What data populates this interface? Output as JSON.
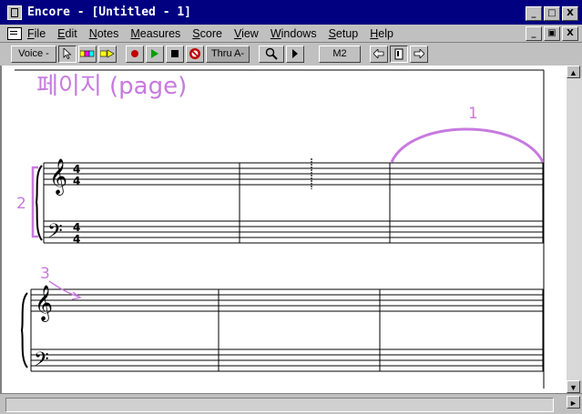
{
  "window": {
    "title": "Encore - [Untitled - 1]",
    "minimize_glyph": "_",
    "restore_glyph": "□",
    "close_glyph": "X"
  },
  "doc_controls": {
    "minimize_glyph": "_",
    "restore_glyph": "▣",
    "close_glyph": "X"
  },
  "menu": [
    "File",
    "Edit",
    "Notes",
    "Measures",
    "Score",
    "View",
    "Windows",
    "Setup",
    "Help"
  ],
  "toolbar": {
    "voice_label": "Voice -",
    "thru_label": "Thru A-",
    "measure_label": "M2",
    "icons": [
      "arrow-pointer-icon",
      "color-voice-icon",
      "color-arrow-icon",
      "record-icon",
      "play-icon",
      "stop-icon",
      "midi-panic-icon",
      "zoom-icon",
      "expand-icon",
      "prev-page-icon",
      "page-icon",
      "next-page-icon"
    ],
    "colors": {
      "record": "#c00000",
      "play": "#00a000",
      "panic": "#c00000"
    }
  },
  "score": {
    "page_label": "페이지 (page)",
    "annotation_1": "1",
    "annotation_2": "2",
    "annotation_3": "3",
    "time_signature": [
      "4",
      "4"
    ],
    "annotation_color": "#c77adf"
  },
  "scrollbar": {
    "up_glyph": "▲",
    "down_glyph": "▼",
    "right_glyph": "►"
  }
}
